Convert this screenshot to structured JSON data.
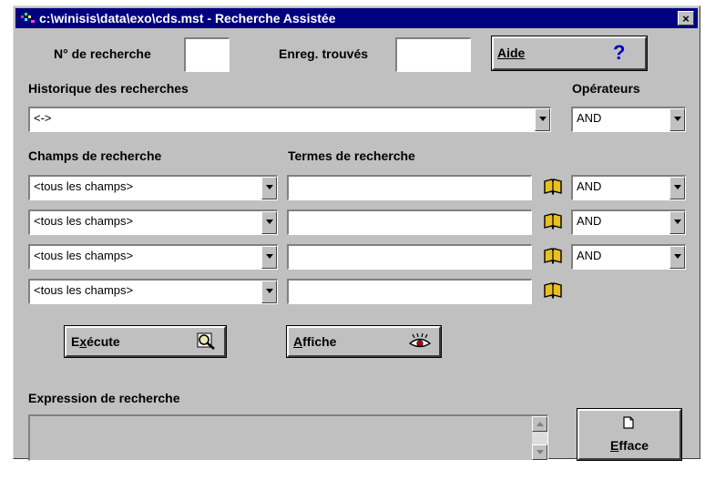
{
  "window": {
    "title": "c:\\winisis\\data\\exo\\cds.mst - Recherche Assistée",
    "close_label": "×"
  },
  "top": {
    "search_no_label": "N° de recherche",
    "records_found_label": "Enreg. trouvés",
    "help_label": "Aide",
    "help_icon_glyph": "?"
  },
  "history": {
    "label": "Historique des recherches",
    "value": "<->"
  },
  "operators": {
    "label": "Opérateurs",
    "first": "AND"
  },
  "fields": {
    "label": "Champs de recherche",
    "terms_label": "Termes de recherche",
    "rows": [
      {
        "field": "<tous les champs>",
        "term": "",
        "operator": "AND"
      },
      {
        "field": "<tous les champs>",
        "term": "",
        "operator": "AND"
      },
      {
        "field": "<tous les champs>",
        "term": "",
        "operator": "AND"
      },
      {
        "field": "<tous les champs>",
        "term": ""
      }
    ]
  },
  "actions": {
    "execute_pre": "E",
    "execute_u": "x",
    "execute_post": "écute",
    "display_u": "A",
    "display_post": "ffiche"
  },
  "expression": {
    "label": "Expression de recherche",
    "value": ""
  },
  "clear": {
    "u": "E",
    "post": "fface"
  },
  "colors": {
    "title_bar": "#000080",
    "window_bg": "#c0c0c0",
    "book_icon": "#c8a000"
  }
}
